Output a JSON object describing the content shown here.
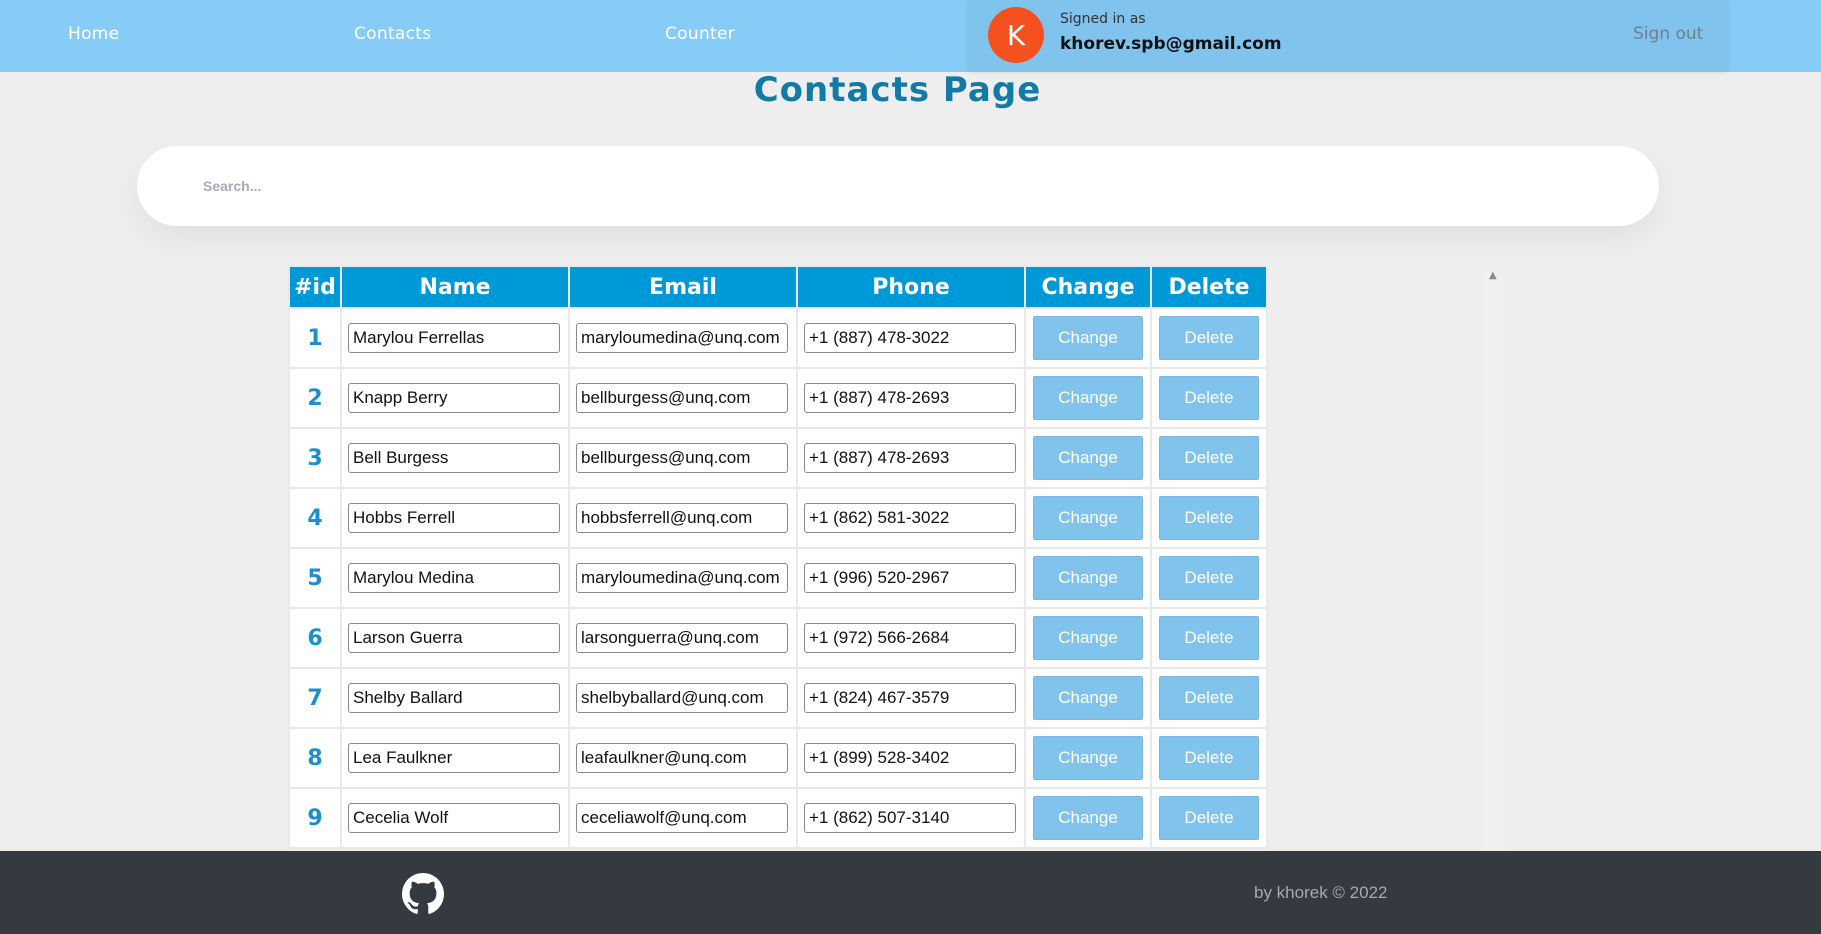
{
  "nav": {
    "home": "Home",
    "contacts": "Contacts",
    "counter": "Counter"
  },
  "user": {
    "avatar_letter": "K",
    "signed_label": "Signed in as",
    "email": "khorev.spb@gmail.com",
    "signout": "Sign out"
  },
  "page": {
    "title": "Contacts Page"
  },
  "search": {
    "placeholder": "Search..."
  },
  "table": {
    "headers": {
      "id": "#id",
      "name": "Name",
      "email": "Email",
      "phone": "Phone",
      "change": "Change",
      "delete": "Delete"
    },
    "change_label": "Change",
    "delete_label": "Delete",
    "rows": [
      {
        "id": "1",
        "name": "Marylou Ferrellas",
        "email": "maryloumedina@unq.com",
        "phone": "+1 (887) 478-3022"
      },
      {
        "id": "2",
        "name": "Knapp Berry",
        "email": "bellburgess@unq.com",
        "phone": "+1 (887) 478-2693"
      },
      {
        "id": "3",
        "name": "Bell Burgess",
        "email": "bellburgess@unq.com",
        "phone": "+1 (887) 478-2693"
      },
      {
        "id": "4",
        "name": "Hobbs Ferrell",
        "email": "hobbsferrell@unq.com",
        "phone": "+1 (862) 581-3022"
      },
      {
        "id": "5",
        "name": "Marylou Medina",
        "email": "maryloumedina@unq.com",
        "phone": "+1 (996) 520-2967"
      },
      {
        "id": "6",
        "name": "Larson Guerra",
        "email": "larsonguerra@unq.com",
        "phone": "+1 (972) 566-2684"
      },
      {
        "id": "7",
        "name": "Shelby Ballard",
        "email": "shelbyballard@unq.com",
        "phone": "+1 (824) 467-3579"
      },
      {
        "id": "8",
        "name": "Lea Faulkner",
        "email": "leafaulkner@unq.com",
        "phone": "+1 (899) 528-3402"
      },
      {
        "id": "9",
        "name": "Cecelia Wolf",
        "email": "ceceliawolf@unq.com",
        "phone": "+1 (862) 507-3140"
      }
    ]
  },
  "footer": {
    "credit": "by khorek © 2022",
    "icon": "github-icon"
  },
  "colors": {
    "header_bg": "#87ccf7",
    "accent": "#0099d8",
    "button_bg": "#80c3ec",
    "avatar_bg": "#f4511e",
    "footer_bg": "#343a40",
    "title": "#137aa6"
  }
}
